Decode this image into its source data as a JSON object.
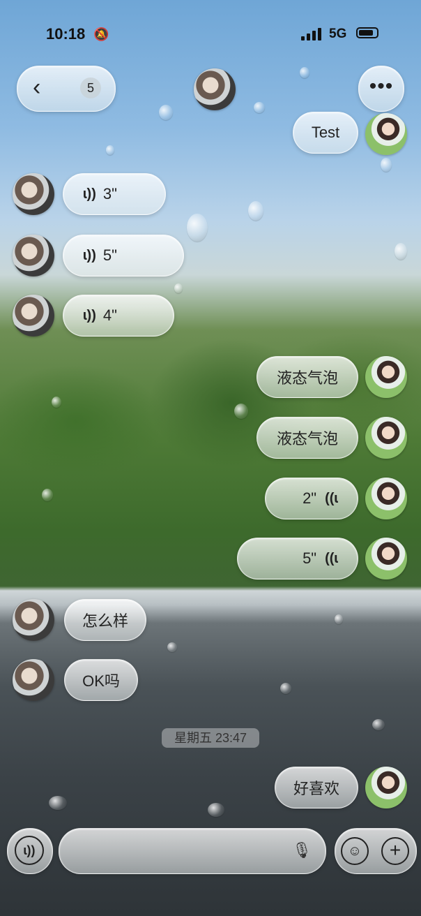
{
  "status_bar": {
    "time": "10:18",
    "mute_icon": "bell-slash-icon",
    "network": "5G"
  },
  "nav": {
    "back_icon": "chevron-left-icon",
    "unread_count": "5",
    "more_icon": "ellipsis-icon"
  },
  "messages": [
    {
      "side": "right",
      "type": "text",
      "text": "Test"
    },
    {
      "side": "left",
      "type": "voice",
      "duration": "3\""
    },
    {
      "side": "left",
      "type": "voice",
      "duration": "5\""
    },
    {
      "side": "left",
      "type": "voice",
      "duration": "4\""
    },
    {
      "side": "right",
      "type": "text",
      "text": "液态气泡"
    },
    {
      "side": "right",
      "type": "text",
      "text": "液态气泡"
    },
    {
      "side": "right",
      "type": "voice",
      "duration": "2\""
    },
    {
      "side": "right",
      "type": "voice",
      "duration": "5\""
    },
    {
      "side": "left",
      "type": "text",
      "text": "怎么样"
    },
    {
      "side": "left",
      "type": "text",
      "text": "OK吗"
    },
    {
      "side": "right",
      "type": "text",
      "text": "好喜欢"
    }
  ],
  "timestamp": "星期五 23:47",
  "input": {
    "voice_icon": "voice-icon",
    "mic_icon": "microphone-icon",
    "emoji_icon": "emoji-icon",
    "plus_icon": "plus-icon",
    "value": ""
  }
}
